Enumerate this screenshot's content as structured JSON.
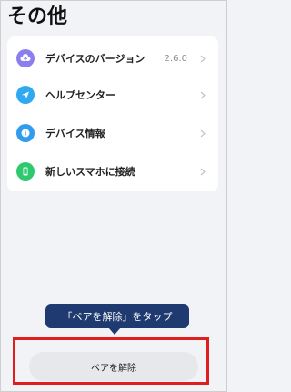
{
  "header": {
    "title": "その他"
  },
  "menu": {
    "items": [
      {
        "label": "デバイスのバージョン",
        "value": "2.6.0",
        "icon": "cloud-upload-icon",
        "icon_color": "#8b7ff0"
      },
      {
        "label": "ヘルプセンター",
        "icon": "send-icon",
        "icon_color": "#2fa9f0"
      },
      {
        "label": "デバイス情報",
        "icon": "info-icon",
        "icon_color": "#2f9cf0"
      },
      {
        "label": "新しいスマホに接続",
        "icon": "phone-icon",
        "icon_color": "#2ec86e"
      }
    ]
  },
  "tooltip": {
    "text": "「ペアを解除」をタップ"
  },
  "footer": {
    "unpair_label": "ペアを解除"
  },
  "colors": {
    "background": "#f2f3f7",
    "tooltip": "#1e3a70",
    "highlight": "#e01e1e"
  }
}
